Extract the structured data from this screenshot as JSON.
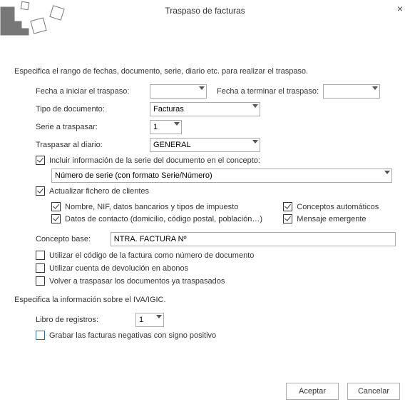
{
  "title": "Traspaso de facturas",
  "intro": "Especifica el rango de fechas, documento, serie, diario etc. para realizar el traspaso.",
  "fields": {
    "fecha_iniciar_label": "Fecha a iniciar el traspaso:",
    "fecha_iniciar_value": "",
    "fecha_terminar_label": "Fecha a terminar el traspaso:",
    "fecha_terminar_value": "",
    "tipo_doc_label": "Tipo de documento:",
    "tipo_doc_value": "Facturas",
    "serie_label": "Serie a traspasar:",
    "serie_value": "1",
    "diario_label": "Traspasar al diario:",
    "diario_value": "GENERAL"
  },
  "chk_incluir_serie": {
    "checked": true,
    "label": "Incluir información de la serie del documento en el concepto:",
    "select_value": "Número de serie (con formato Serie/Número)"
  },
  "chk_actualizar": {
    "checked": true,
    "label": "Actualizar fichero de clientes",
    "sub": {
      "nombre": {
        "checked": true,
        "label": "Nombre, NIF, datos bancarios y tipos de impuesto"
      },
      "datos_contacto": {
        "checked": true,
        "label": "Datos de contacto (domicilio, código postal, población…)"
      },
      "conceptos_auto": {
        "checked": true,
        "label": "Conceptos automáticos"
      },
      "mensaje_emergente": {
        "checked": true,
        "label": "Mensaje emergente"
      }
    }
  },
  "concepto_base": {
    "label": "Concepto base:",
    "value": "NTRA. FACTURA Nº"
  },
  "chk_utilizar_codigo": {
    "checked": false,
    "label": "Utilizar el código de la factura como número de documento"
  },
  "chk_utilizar_cuenta": {
    "checked": false,
    "label": "Utilizar cuenta de devolución en abonos"
  },
  "chk_volver_traspasar": {
    "checked": false,
    "label": "Volver a traspasar los documentos ya traspasados"
  },
  "iva_section": "Especifica la información sobre el IVA/IGIC.",
  "libro_label": "Libro de registros:",
  "libro_value": "1",
  "chk_grabar_neg": {
    "checked": false,
    "label": "Grabar las facturas negativas con signo positivo"
  },
  "buttons": {
    "accept": "Aceptar",
    "cancel": "Cancelar"
  }
}
